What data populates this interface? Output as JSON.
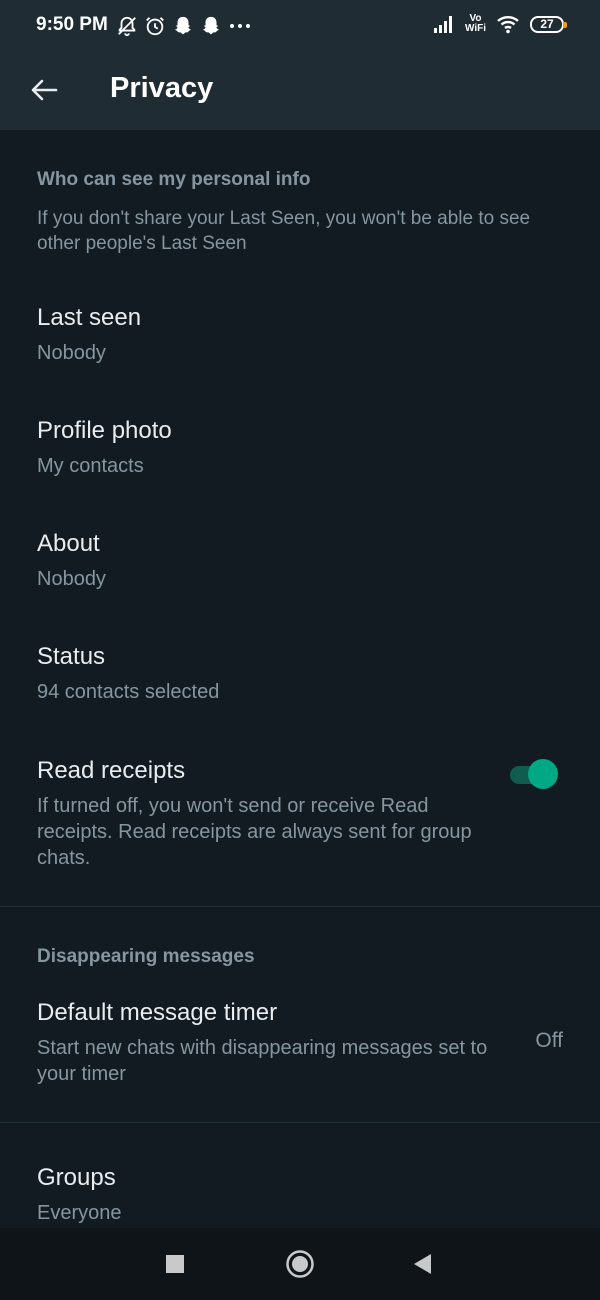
{
  "status_bar": {
    "time": "9:50 PM",
    "left_icons": [
      "bell-off-icon",
      "alarm-icon",
      "snapchat-icon",
      "snapchat-icon",
      "more-dots-icon"
    ],
    "signal_icon": "signal-icon",
    "vowifi_top": "Vo",
    "vowifi_bottom": "WiFi",
    "wifi_icon": "wifi-icon",
    "battery": "27"
  },
  "app_bar": {
    "back_icon": "arrow-left-icon",
    "title": "Privacy"
  },
  "personal_info": {
    "header": "Who can see my personal info",
    "description": "If you don't share your Last Seen, you won't be able to see other people's Last Seen",
    "items": [
      {
        "title": "Last seen",
        "subtitle": "Nobody"
      },
      {
        "title": "Profile photo",
        "subtitle": "My contacts"
      },
      {
        "title": "About",
        "subtitle": "Nobody"
      },
      {
        "title": "Status",
        "subtitle": "94 contacts selected"
      }
    ],
    "read_receipts": {
      "title": "Read receipts",
      "subtitle": "If turned off, you won't send or receive Read receipts. Read receipts are always sent for group chats.",
      "enabled": true
    }
  },
  "disappearing": {
    "header": "Disappearing messages",
    "timer": {
      "title": "Default message timer",
      "subtitle": "Start new chats with disappearing messages set to your timer",
      "value": "Off"
    }
  },
  "groups": {
    "title": "Groups",
    "subtitle": "Everyone"
  },
  "nav_bar": {
    "buttons": [
      "recents-square-icon",
      "home-circle-icon",
      "back-triangle-icon"
    ]
  },
  "colors": {
    "background": "#121b22",
    "app_bar": "#1f2c34",
    "accent": "#00a884",
    "secondary_text": "#8696a0"
  }
}
